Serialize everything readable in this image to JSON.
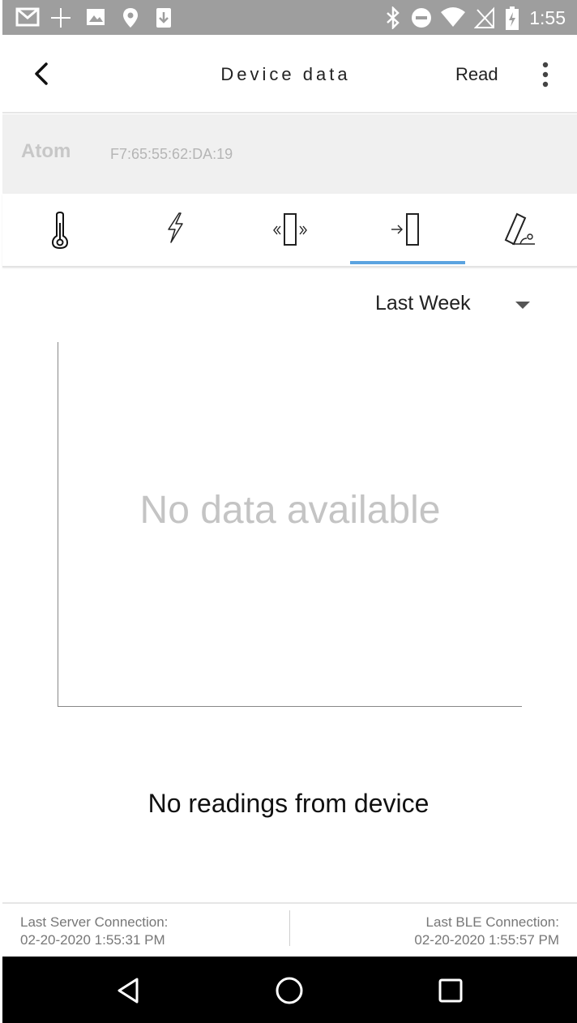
{
  "status_bar": {
    "time": "1:55",
    "left_icons": [
      "gmail-icon",
      "signal-crosshair-icon",
      "image-icon",
      "location-icon",
      "download-icon"
    ],
    "right_icons": [
      "bluetooth-icon",
      "do-not-disturb-icon",
      "wifi-icon",
      "no-signal-icon",
      "battery-charging-icon"
    ]
  },
  "app_bar": {
    "title": "Device data",
    "read_label": "Read"
  },
  "device": {
    "name": "Atom",
    "mac": "F7:65:55:62:DA:19"
  },
  "tabs": [
    {
      "icon": "thermometer-icon"
    },
    {
      "icon": "lightning-icon"
    },
    {
      "icon": "vibration-icon"
    },
    {
      "icon": "door-open-icon",
      "selected": true
    },
    {
      "icon": "tilt-icon"
    }
  ],
  "accent_color": "#5ba3e0",
  "period_select": {
    "selected": "Last Week"
  },
  "chart": {
    "empty_text": "No data available"
  },
  "message": "No readings from device",
  "footer": {
    "server_label": "Last Server Connection:",
    "server_time": "02-20-2020 1:55:31 PM",
    "ble_label": "Last BLE Connection:",
    "ble_time": "02-20-2020 1:55:57 PM"
  },
  "nav_bar": {
    "buttons": [
      "back-icon",
      "home-icon",
      "recents-icon"
    ]
  }
}
